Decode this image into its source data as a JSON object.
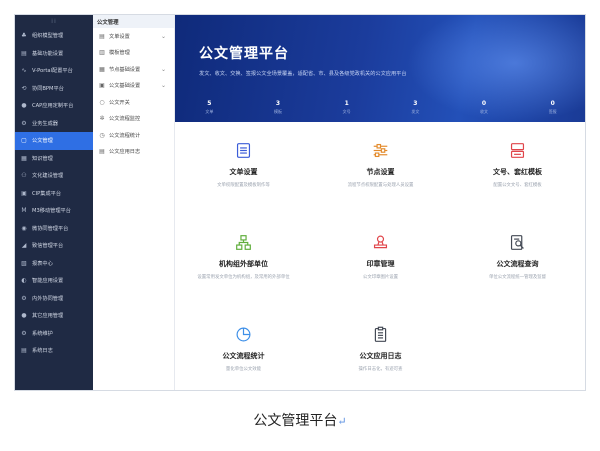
{
  "sidebar": {
    "collapse_glyph": "⁞⁞",
    "items": [
      {
        "label": "组织模型管理",
        "icon": "org-icon",
        "glyph": "♣"
      },
      {
        "label": "基础功能设置",
        "icon": "settings-panel-icon",
        "glyph": "▤"
      },
      {
        "label": "V-Portal配置平台",
        "icon": "portal-icon",
        "glyph": "∿"
      },
      {
        "label": "协同BPM平台",
        "icon": "bpm-icon",
        "glyph": "⟲"
      },
      {
        "label": "CAP应用定制平台",
        "icon": "cap-icon",
        "glyph": "●"
      },
      {
        "label": "业务生成器",
        "icon": "generator-icon",
        "glyph": "⚙"
      },
      {
        "label": "公文管理",
        "icon": "document-icon",
        "glyph": "▢"
      },
      {
        "label": "知识管理",
        "icon": "knowledge-icon",
        "glyph": "▦"
      },
      {
        "label": "文化建设管理",
        "icon": "culture-icon",
        "glyph": "⚇"
      },
      {
        "label": "CIP集成平台",
        "icon": "cip-icon",
        "glyph": "▣"
      },
      {
        "label": "M3移动管理平台",
        "icon": "mobile-icon",
        "glyph": "M"
      },
      {
        "label": "微协同管理平台",
        "icon": "wechat-icon",
        "glyph": "◉"
      },
      {
        "label": "致信管理平台",
        "icon": "zhixin-icon",
        "glyph": "◢"
      },
      {
        "label": "报表中心",
        "icon": "report-icon",
        "glyph": "▧"
      },
      {
        "label": "智能应用设置",
        "icon": "smart-icon",
        "glyph": "◐"
      },
      {
        "label": "内外协同管理",
        "icon": "collab-icon",
        "glyph": "⚙"
      },
      {
        "label": "其它应用管理",
        "icon": "other-app-icon",
        "glyph": "●"
      },
      {
        "label": "系统维护",
        "icon": "maintenance-icon",
        "glyph": "⚙"
      },
      {
        "label": "系统日志",
        "icon": "log-icon",
        "glyph": "▤"
      }
    ]
  },
  "submenu": {
    "title": "公文管理",
    "items": [
      {
        "label": "文单设置",
        "icon": "doc-form-icon",
        "glyph": "▤",
        "chevron": "⌄"
      },
      {
        "label": "模板管理",
        "icon": "template-icon",
        "glyph": "▥",
        "chevron": ""
      },
      {
        "label": "节点基础设置",
        "icon": "node-icon",
        "glyph": "▦",
        "chevron": "⌄"
      },
      {
        "label": "公文基础设置",
        "icon": "doc-base-icon",
        "glyph": "▣",
        "chevron": "⌄"
      },
      {
        "label": "公文开关",
        "icon": "switch-icon",
        "glyph": "○",
        "chevron": ""
      },
      {
        "label": "公文流程监控",
        "icon": "monitor-icon",
        "glyph": "✲",
        "chevron": ""
      },
      {
        "label": "公文流程统计",
        "icon": "stats-icon",
        "glyph": "◷",
        "chevron": ""
      },
      {
        "label": "公文应用日志",
        "icon": "app-log-icon",
        "glyph": "▤",
        "chevron": ""
      }
    ]
  },
  "banner": {
    "title": "公文管理平台",
    "subtitle": "发文、收文、交换、签报公文全场景覆盖，适配省、市、县及各级党政机关的公文应用平台",
    "stats": [
      {
        "value": "5",
        "label": "文单"
      },
      {
        "value": "3",
        "label": "模板"
      },
      {
        "value": "1",
        "label": "文号"
      },
      {
        "value": "3",
        "label": "发文"
      },
      {
        "value": "0",
        "label": "收文"
      },
      {
        "value": "0",
        "label": "签报"
      }
    ]
  },
  "cards": [
    {
      "name": "文单设置",
      "desc": "文单权限配置及模板制作等",
      "icon": "form-settings-icon",
      "color": "#3c5dd8"
    },
    {
      "name": "节点设置",
      "desc": "流程节点权限配置与处理人员设置",
      "icon": "node-settings-icon",
      "color": "#e38b2c"
    },
    {
      "name": "文号、套红模板",
      "desc": "配置公文文号、套红模板",
      "icon": "red-template-icon",
      "color": "#e0454a"
    },
    {
      "name": "机构组外部单位",
      "desc": "设置常用发文单位为机构组，及常用的外部单位",
      "icon": "org-unit-icon",
      "color": "#5fae3c"
    },
    {
      "name": "印章管理",
      "desc": "公文印章图片设置",
      "icon": "seal-icon",
      "color": "#e0454a"
    },
    {
      "name": "公文流程查询",
      "desc": "单位公文流程统一管理及监督",
      "icon": "flow-query-icon",
      "color": "#444a55"
    },
    {
      "name": "公文流程统计",
      "desc": "量化单位公文效能",
      "icon": "flow-stats-icon",
      "color": "#3d8fe8"
    },
    {
      "name": "公文应用日志",
      "desc": "操作日志化，有迹可查",
      "icon": "app-log-card-icon",
      "color": "#444a55"
    }
  ],
  "caption": {
    "text": "公文管理平台",
    "return_mark": "↵"
  }
}
